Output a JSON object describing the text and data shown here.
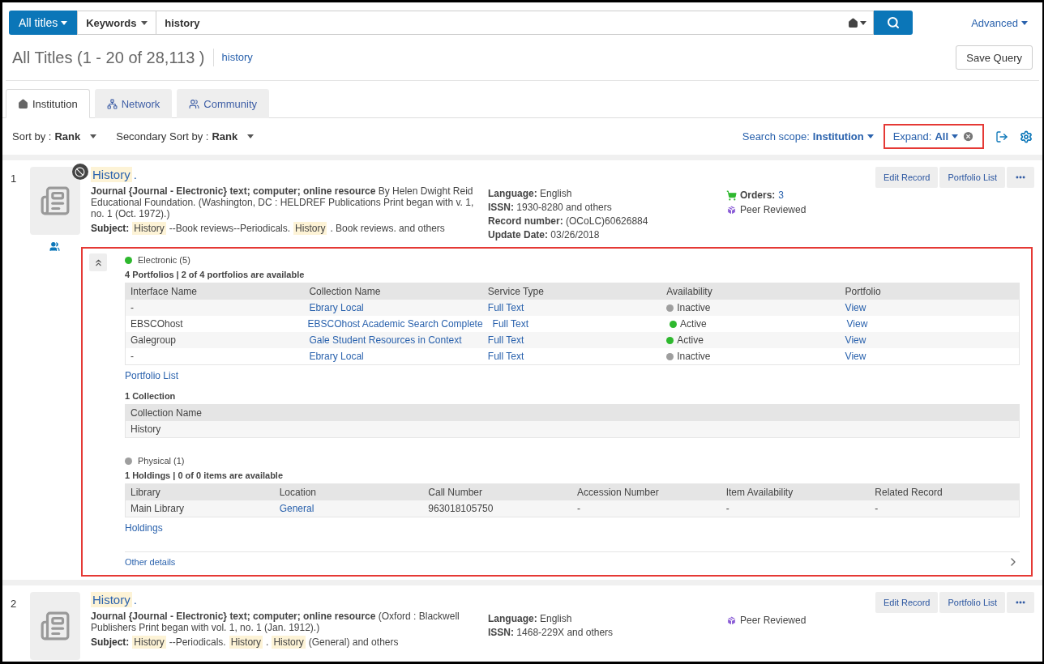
{
  "search_bar": {
    "scope": "All titles",
    "field": "Keywords",
    "query": "history",
    "advanced": "Advanced"
  },
  "header": {
    "title": "All Titles (1 - 20 of 28,113 )",
    "query_link": "history",
    "save_button": "Save Query"
  },
  "tabs": [
    {
      "label": "Institution",
      "selected": true
    },
    {
      "label": "Network",
      "selected": false
    },
    {
      "label": "Community",
      "selected": false
    }
  ],
  "toolbar": {
    "sort_label": "Sort by :",
    "sort_value": "Rank",
    "secondary_label": "Secondary Sort by :",
    "secondary_value": "Rank",
    "scope_label": "Search scope:",
    "scope_value": "Institution",
    "expand_label": "Expand:",
    "expand_value": "All",
    "expand_highlighted": true
  },
  "records": [
    {
      "number": "1",
      "title": "History",
      "title_end": ".",
      "unavailable_badge": true,
      "community": true,
      "description": "**Journal {Journal - Electronic} text; computer; online resource** By Helen Dwight Reid Educational Foundation. (Washington, DC : HELDREF Publications Print began with v. 1, no. 1 (Oct. 1972).)",
      "subject_label": "Subject:",
      "subject": [
        {
          "text": "History",
          "highlighted": true
        },
        {
          "text": "--Book reviews--Periodicals.",
          "highlighted": false
        },
        {
          "text": "History",
          "highlighted": true
        },
        {
          "text": ". Book reviews. and others",
          "highlighted": false
        }
      ],
      "details": [
        {
          "label": "Language:",
          "value": "English"
        },
        {
          "label": "ISSN:",
          "value": "1930-8280 and others"
        },
        {
          "label": "Record number:",
          "value": "(OCoLC)60626884"
        },
        {
          "label": "Update Date:",
          "value": "03/26/2018"
        }
      ],
      "side": [
        {
          "kind": "orders",
          "label": "Orders:",
          "value": "3"
        },
        {
          "kind": "peer",
          "label": "Peer Reviewed"
        }
      ],
      "buttons": [
        "Edit Record",
        "Portfolio List"
      ],
      "expanded": {
        "highlighted": true,
        "sections": [
          {
            "kind": "inventory",
            "color": "#2eb82e",
            "heading": "Electronic (5)",
            "summary": "4 Portfolios | 2 of 4 portfolios are available",
            "columns": [
              {
                "label": "Interface Name",
                "kind": "text"
              },
              {
                "label": "Collection Name",
                "kind": "link"
              },
              {
                "label": "Service Type",
                "kind": "link"
              },
              {
                "label": "Availability",
                "kind": "status"
              },
              {
                "label": "Portfolio",
                "kind": "link"
              }
            ],
            "rows": [
              {
                "cells": [
                  "-",
                  "Ebrary Local",
                  "Full Text",
                  "Inactive",
                  "View"
                ],
                "color": "#9e9e9e"
              },
              {
                "cells": [
                  "EBSCOhost",
                  "EBSCOhost Academic Search Complete",
                  "Full Text",
                  "Active",
                  "View"
                ],
                "color": "#2eb82e"
              },
              {
                "cells": [
                  "Galegroup",
                  "Gale Student Resources in Context",
                  "Full Text",
                  "Active",
                  "View"
                ],
                "color": "#2eb82e"
              },
              {
                "cells": [
                  "-",
                  "Ebrary Local",
                  "Full Text",
                  "Inactive",
                  "View"
                ],
                "color": "#9e9e9e"
              }
            ],
            "link": "Portfolio List"
          },
          {
            "kind": "plain",
            "summary": "1 Collection",
            "columns": [
              {
                "label": "Collection Name",
                "kind": "text"
              }
            ],
            "rows": [
              {
                "cells": [
                  "History"
                ]
              }
            ]
          },
          {
            "kind": "inventory",
            "color": "#9e9e9e",
            "heading": "Physical (1)",
            "summary": "1 Holdings | 0 of 0 items are available",
            "columns": [
              {
                "label": "Library",
                "kind": "text"
              },
              {
                "label": "Location",
                "kind": "link"
              },
              {
                "label": "Call Number",
                "kind": "text"
              },
              {
                "label": "Accession Number",
                "kind": "text"
              },
              {
                "label": "Item Availability",
                "kind": "text"
              },
              {
                "label": "Related Record",
                "kind": "text"
              }
            ],
            "rows": [
              {
                "cells": [
                  "Main Library",
                  "General",
                  "963018105750",
                  "-",
                  "-",
                  "-"
                ]
              }
            ],
            "link": "Holdings"
          }
        ],
        "other_details": "Other details"
      }
    },
    {
      "number": "2",
      "title": "History",
      "title_end": ".",
      "description": "**Journal {Journal - Electronic} text; computer; online resource** (Oxford : Blackwell Publishers Print began with vol. 1, no. 1 (Jan. 1912).)",
      "subject_label": "Subject:",
      "subject": [
        {
          "text": "History",
          "highlighted": true
        },
        {
          "text": "--Periodicals.",
          "highlighted": false
        },
        {
          "text": "History",
          "highlighted": true
        },
        {
          "text": ".",
          "highlighted": false
        },
        {
          "text": "History",
          "highlighted": true
        },
        {
          "text": "(General) and others",
          "highlighted": false
        }
      ],
      "details": [
        {
          "label": "Language:",
          "value": "English"
        },
        {
          "label": "ISSN:",
          "value": "1468-229X and others"
        }
      ],
      "side": [
        {
          "kind": "peer",
          "label": "Peer Reviewed"
        }
      ],
      "buttons": [
        "Edit Record",
        "Portfolio List"
      ]
    }
  ]
}
